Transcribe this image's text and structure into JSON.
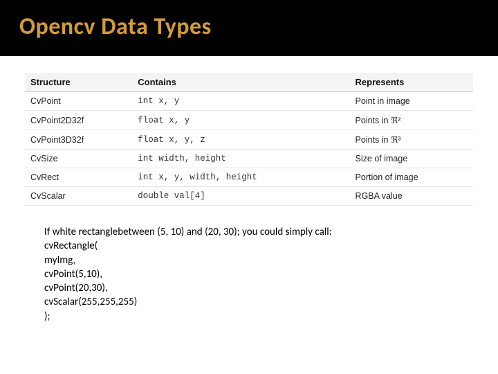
{
  "title": "Opencv Data Types",
  "table": {
    "headers": [
      "Structure",
      "Contains",
      "Represents"
    ],
    "rows": [
      {
        "structure": "CvPoint",
        "contains": "int x, y",
        "represents": "Point in image"
      },
      {
        "structure": "CvPoint2D32f",
        "contains": "float x, y",
        "represents": "Points in ℜ²"
      },
      {
        "structure": "CvPoint3D32f",
        "contains": "float x, y, z",
        "represents": "Points in ℜ³"
      },
      {
        "structure": "CvSize",
        "contains": "int width, height",
        "represents": "Size of image"
      },
      {
        "structure": "CvRect",
        "contains": "int x, y, width, height",
        "represents": "Portion of image"
      },
      {
        "structure": "CvScalar",
        "contains": "double val[4]",
        "represents": "RGBA value"
      }
    ]
  },
  "code_lines": [
    "If white rectanglebetween (5, 10) and (20, 30); you could simply call:",
    "cvRectangle(",
    "myImg,",
    "cvPoint(5,10),",
    "cvPoint(20,30),",
    "cvScalar(255,255,255)",
    ");"
  ]
}
